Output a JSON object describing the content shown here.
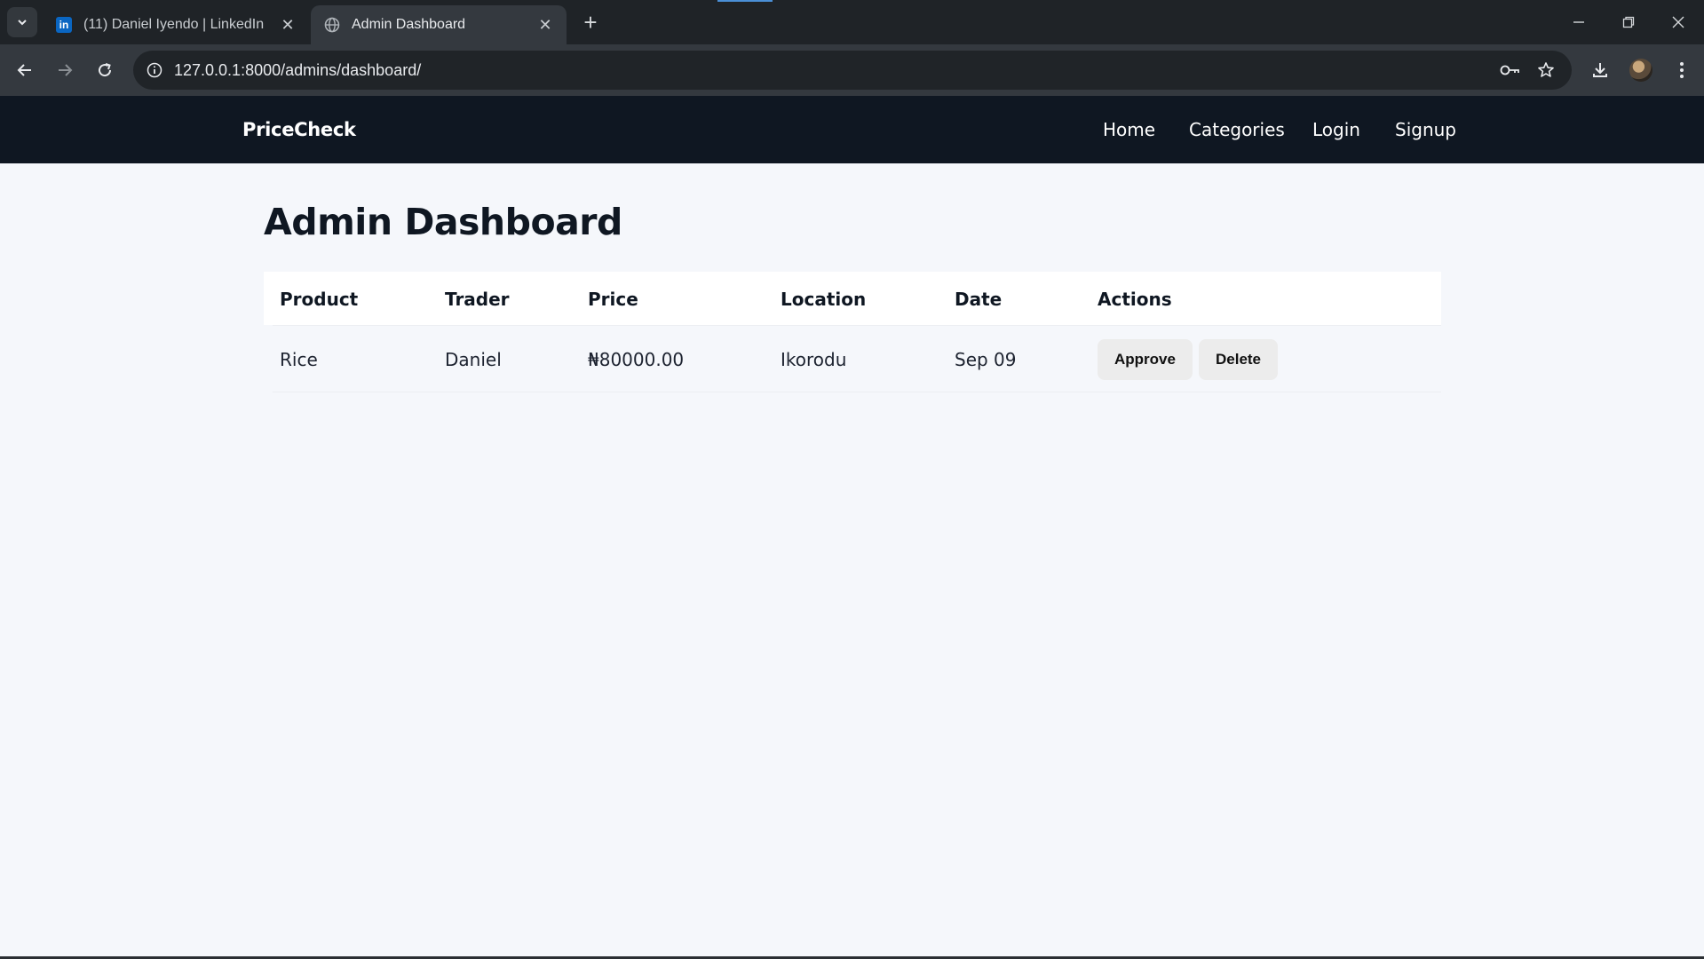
{
  "browser": {
    "tabs": [
      {
        "title": "(11) Daniel Iyendo | LinkedIn",
        "favicon": "linkedin-icon",
        "active": false
      },
      {
        "title": "Admin Dashboard",
        "favicon": "globe-icon",
        "active": true
      }
    ],
    "url": "127.0.0.1:8000/admins/dashboard/"
  },
  "site": {
    "brand": "PriceCheck",
    "nav": [
      {
        "label": "Home"
      },
      {
        "label": "Categories"
      },
      {
        "label": "Login"
      },
      {
        "label": "Signup"
      }
    ]
  },
  "main": {
    "title": "Admin Dashboard",
    "table": {
      "headers": [
        "Product",
        "Trader",
        "Price",
        "Location",
        "Date",
        "Actions"
      ],
      "rows": [
        {
          "product": "Rice",
          "trader": "Daniel",
          "price": "₦80000.00",
          "location": "Ikorodu",
          "date": "Sep 09",
          "approve_label": "Approve",
          "delete_label": "Delete"
        }
      ]
    }
  }
}
